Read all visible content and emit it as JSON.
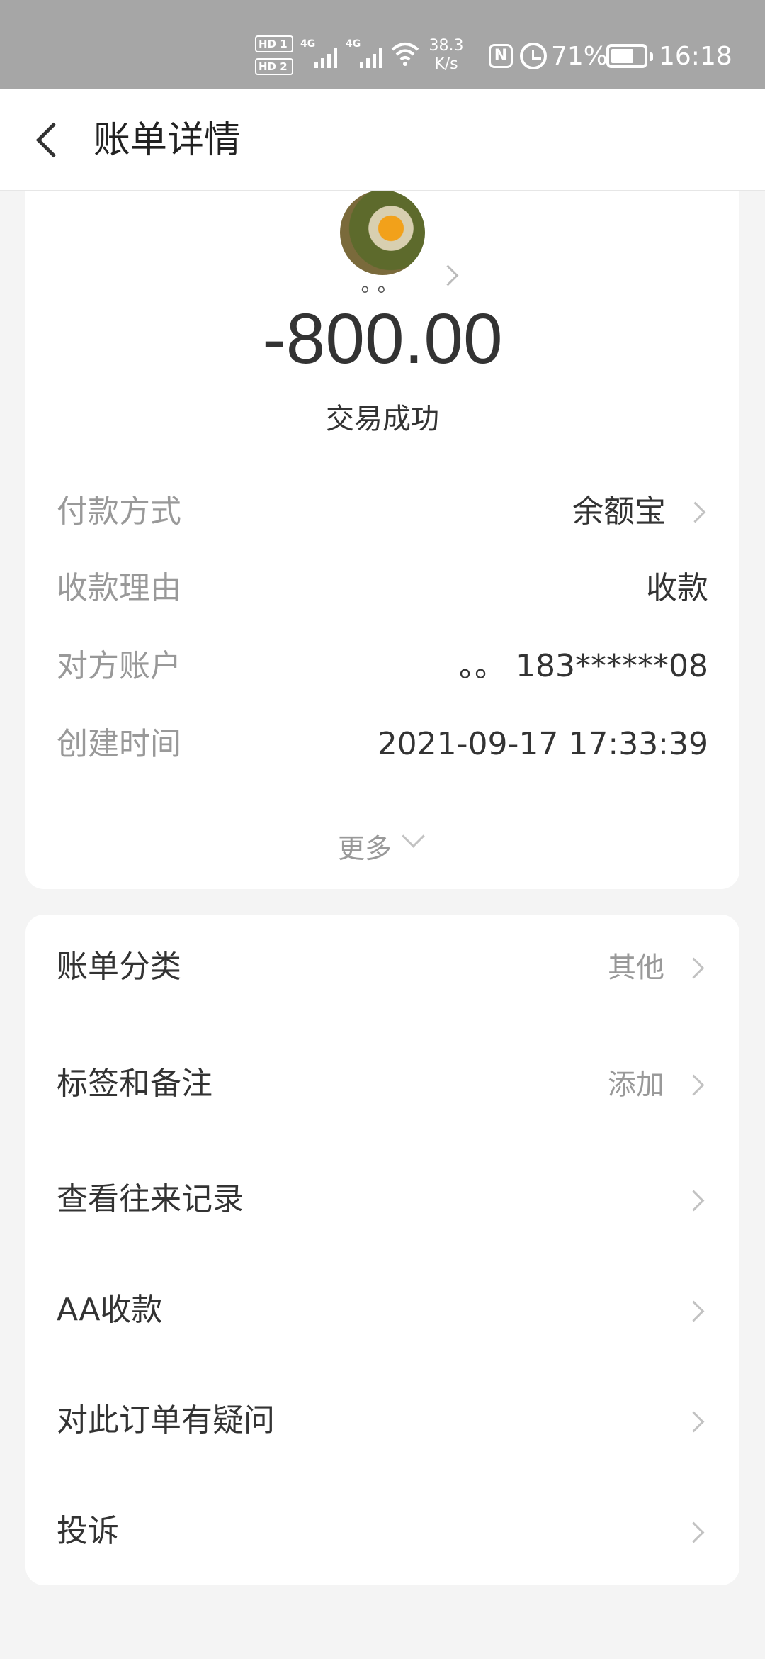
{
  "status_bar": {
    "hd1": "HD 1",
    "hd2": "HD 2",
    "net1": "4G",
    "net2": "4G",
    "speed_value": "38.3",
    "speed_unit": "K/s",
    "nfc_label": "N",
    "battery_percent": "71%",
    "battery_level": 0.71,
    "time": "16:18"
  },
  "header": {
    "title": "账单详情"
  },
  "summary": {
    "payee_name": "。。",
    "amount": "-800.00",
    "status": "交易成功"
  },
  "details": [
    {
      "label": "付款方式",
      "value": "余额宝"
    },
    {
      "label": "收款理由",
      "value": "收款"
    },
    {
      "label": "对方账户",
      "value": "。。 183******08"
    },
    {
      "label": "创建时间",
      "value": "2021-09-17 17:33:39"
    }
  ],
  "more_label": "更多",
  "menu": [
    {
      "label": "账单分类",
      "value": "其他"
    },
    {
      "label": "标签和备注",
      "value": "添加"
    },
    {
      "label": "查看往来记录",
      "value": ""
    },
    {
      "label": "AA收款",
      "value": ""
    },
    {
      "label": "对此订单有疑问",
      "value": ""
    },
    {
      "label": "投诉",
      "value": ""
    }
  ]
}
